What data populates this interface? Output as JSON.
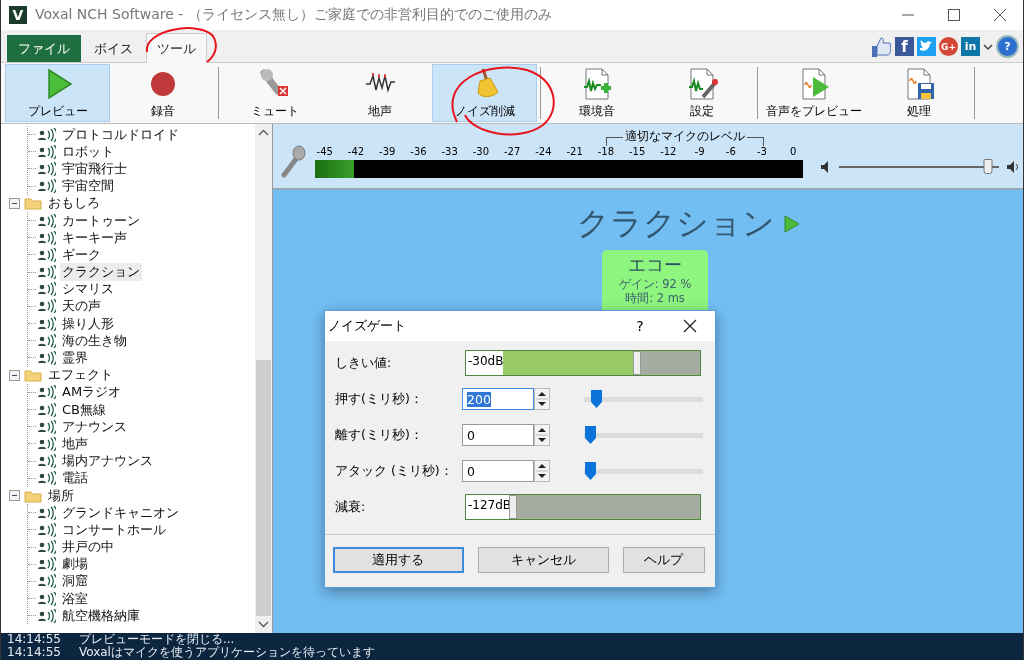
{
  "window": {
    "logo": "V",
    "title": "Voxal NCH Software - （ライセンス無し）ご家庭での非営利目的でのご使用のみ"
  },
  "tabs": [
    {
      "label": "ファイル",
      "kind": "file",
      "selected": false
    },
    {
      "label": "ボイス",
      "kind": "tab",
      "selected": false
    },
    {
      "label": "ツール",
      "kind": "tab",
      "selected": true
    }
  ],
  "social": [
    {
      "kind": "like"
    },
    {
      "kind": "facebook",
      "glyph": "f"
    },
    {
      "kind": "twitter"
    },
    {
      "kind": "google",
      "glyph": "G+"
    },
    {
      "kind": "linkedin",
      "glyph": "in"
    },
    {
      "kind": "dropdown"
    },
    {
      "kind": "help",
      "glyph": "?"
    }
  ],
  "toolbar": [
    {
      "buttons": [
        {
          "label": "プレビュー",
          "kind": "play",
          "selected": true
        },
        {
          "label": "録音",
          "kind": "record",
          "selected": false
        }
      ]
    },
    {
      "buttons": [
        {
          "label": "ミュート",
          "kind": "mute",
          "selected": false
        },
        {
          "label": "地声",
          "kind": "wave",
          "selected": false
        },
        {
          "label": "ノイズ削減",
          "kind": "broom",
          "selected": true
        }
      ]
    },
    {
      "buttons": [
        {
          "label": "環境音",
          "kind": "doc-add",
          "selected": false
        },
        {
          "label": "設定",
          "kind": "doc-edit",
          "selected": false
        }
      ]
    },
    {
      "buttons": [
        {
          "label": "音声をプレビュー",
          "kind": "doc-play",
          "selected": false
        },
        {
          "label": "処理",
          "kind": "doc-save",
          "selected": false
        }
      ]
    }
  ],
  "tree": {
    "items": [
      {
        "label": "プロトコルドロイド",
        "selected": false
      },
      {
        "label": "ロボット",
        "selected": false
      },
      {
        "label": "宇宙飛行士",
        "selected": false
      },
      {
        "label": "宇宙空間",
        "selected": false
      }
    ],
    "folders": [
      {
        "label": "おもしろ",
        "expanded": true,
        "children": [
          {
            "label": "カートゥーン",
            "selected": false
          },
          {
            "label": "キーキー声",
            "selected": false
          },
          {
            "label": "ギーク",
            "selected": false
          },
          {
            "label": "クラクション",
            "selected": true
          },
          {
            "label": "シマリス",
            "selected": false
          },
          {
            "label": "天の声",
            "selected": false
          },
          {
            "label": "操り人形",
            "selected": false
          },
          {
            "label": "海の生き物",
            "selected": false
          },
          {
            "label": "霊界",
            "selected": false
          }
        ]
      },
      {
        "label": "エフェクト",
        "expanded": true,
        "children": [
          {
            "label": "AMラジオ",
            "selected": false
          },
          {
            "label": "CB無線",
            "selected": false
          },
          {
            "label": "アナウンス",
            "selected": false
          },
          {
            "label": "地声",
            "selected": false
          },
          {
            "label": "場内アナウンス",
            "selected": false
          },
          {
            "label": "電話",
            "selected": false
          }
        ]
      },
      {
        "label": "場所",
        "expanded": true,
        "children": [
          {
            "label": "グランドキャニオン",
            "selected": false
          },
          {
            "label": "コンサートホール",
            "selected": false
          },
          {
            "label": "井戸の中",
            "selected": false
          },
          {
            "label": "劇場",
            "selected": false
          },
          {
            "label": "洞窟",
            "selected": false
          },
          {
            "label": "浴室",
            "selected": false
          },
          {
            "label": "航空機格納庫",
            "selected": false
          }
        ]
      }
    ]
  },
  "meter": {
    "range_label": "適切なマイクのレベル",
    "ticks": [
      "-45",
      "-42",
      "-39",
      "-36",
      "-33",
      "-30",
      "-27",
      "-24",
      "-21",
      "-18",
      "-15",
      "-12",
      "-9",
      "-6",
      "-3",
      "0"
    ],
    "level": 0.08,
    "volume": {
      "level": 0.93
    }
  },
  "stage": {
    "title": "クラクション",
    "effect": {
      "name": "エコー",
      "lines": [
        "ゲイン: 92 %",
        "時間: 2 ms"
      ]
    }
  },
  "dialog": {
    "title": "ノイズゲート",
    "help": "?",
    "rows": [
      {
        "kind": "bar",
        "label": "しきい値:",
        "value": "-30dB",
        "level": 0.73
      },
      {
        "kind": "spin",
        "label": "押す(ミリ秒)：",
        "value": "200",
        "text_selected": true,
        "level": 0.06
      },
      {
        "kind": "spin",
        "label": "離す(ミリ秒)：",
        "value": "0",
        "text_selected": false,
        "level": 0
      },
      {
        "kind": "spin",
        "label": "アタック (ミリ秒)：",
        "value": "0",
        "text_selected": false,
        "level": 0
      },
      {
        "kind": "bar",
        "label": "減衰:",
        "value": "-127dB",
        "level": 0.2
      }
    ],
    "buttons": [
      {
        "label": "適用する",
        "default": true
      },
      {
        "label": "キャンセル",
        "default": false
      },
      {
        "label": "ヘルプ",
        "default": false
      }
    ]
  },
  "log": [
    {
      "time": "14:14:55",
      "message": "プレビューモードを閉じる..."
    },
    {
      "time": "14:14:55",
      "message": "Voxalはマイクを使うアプリケーションを待っています"
    }
  ]
}
